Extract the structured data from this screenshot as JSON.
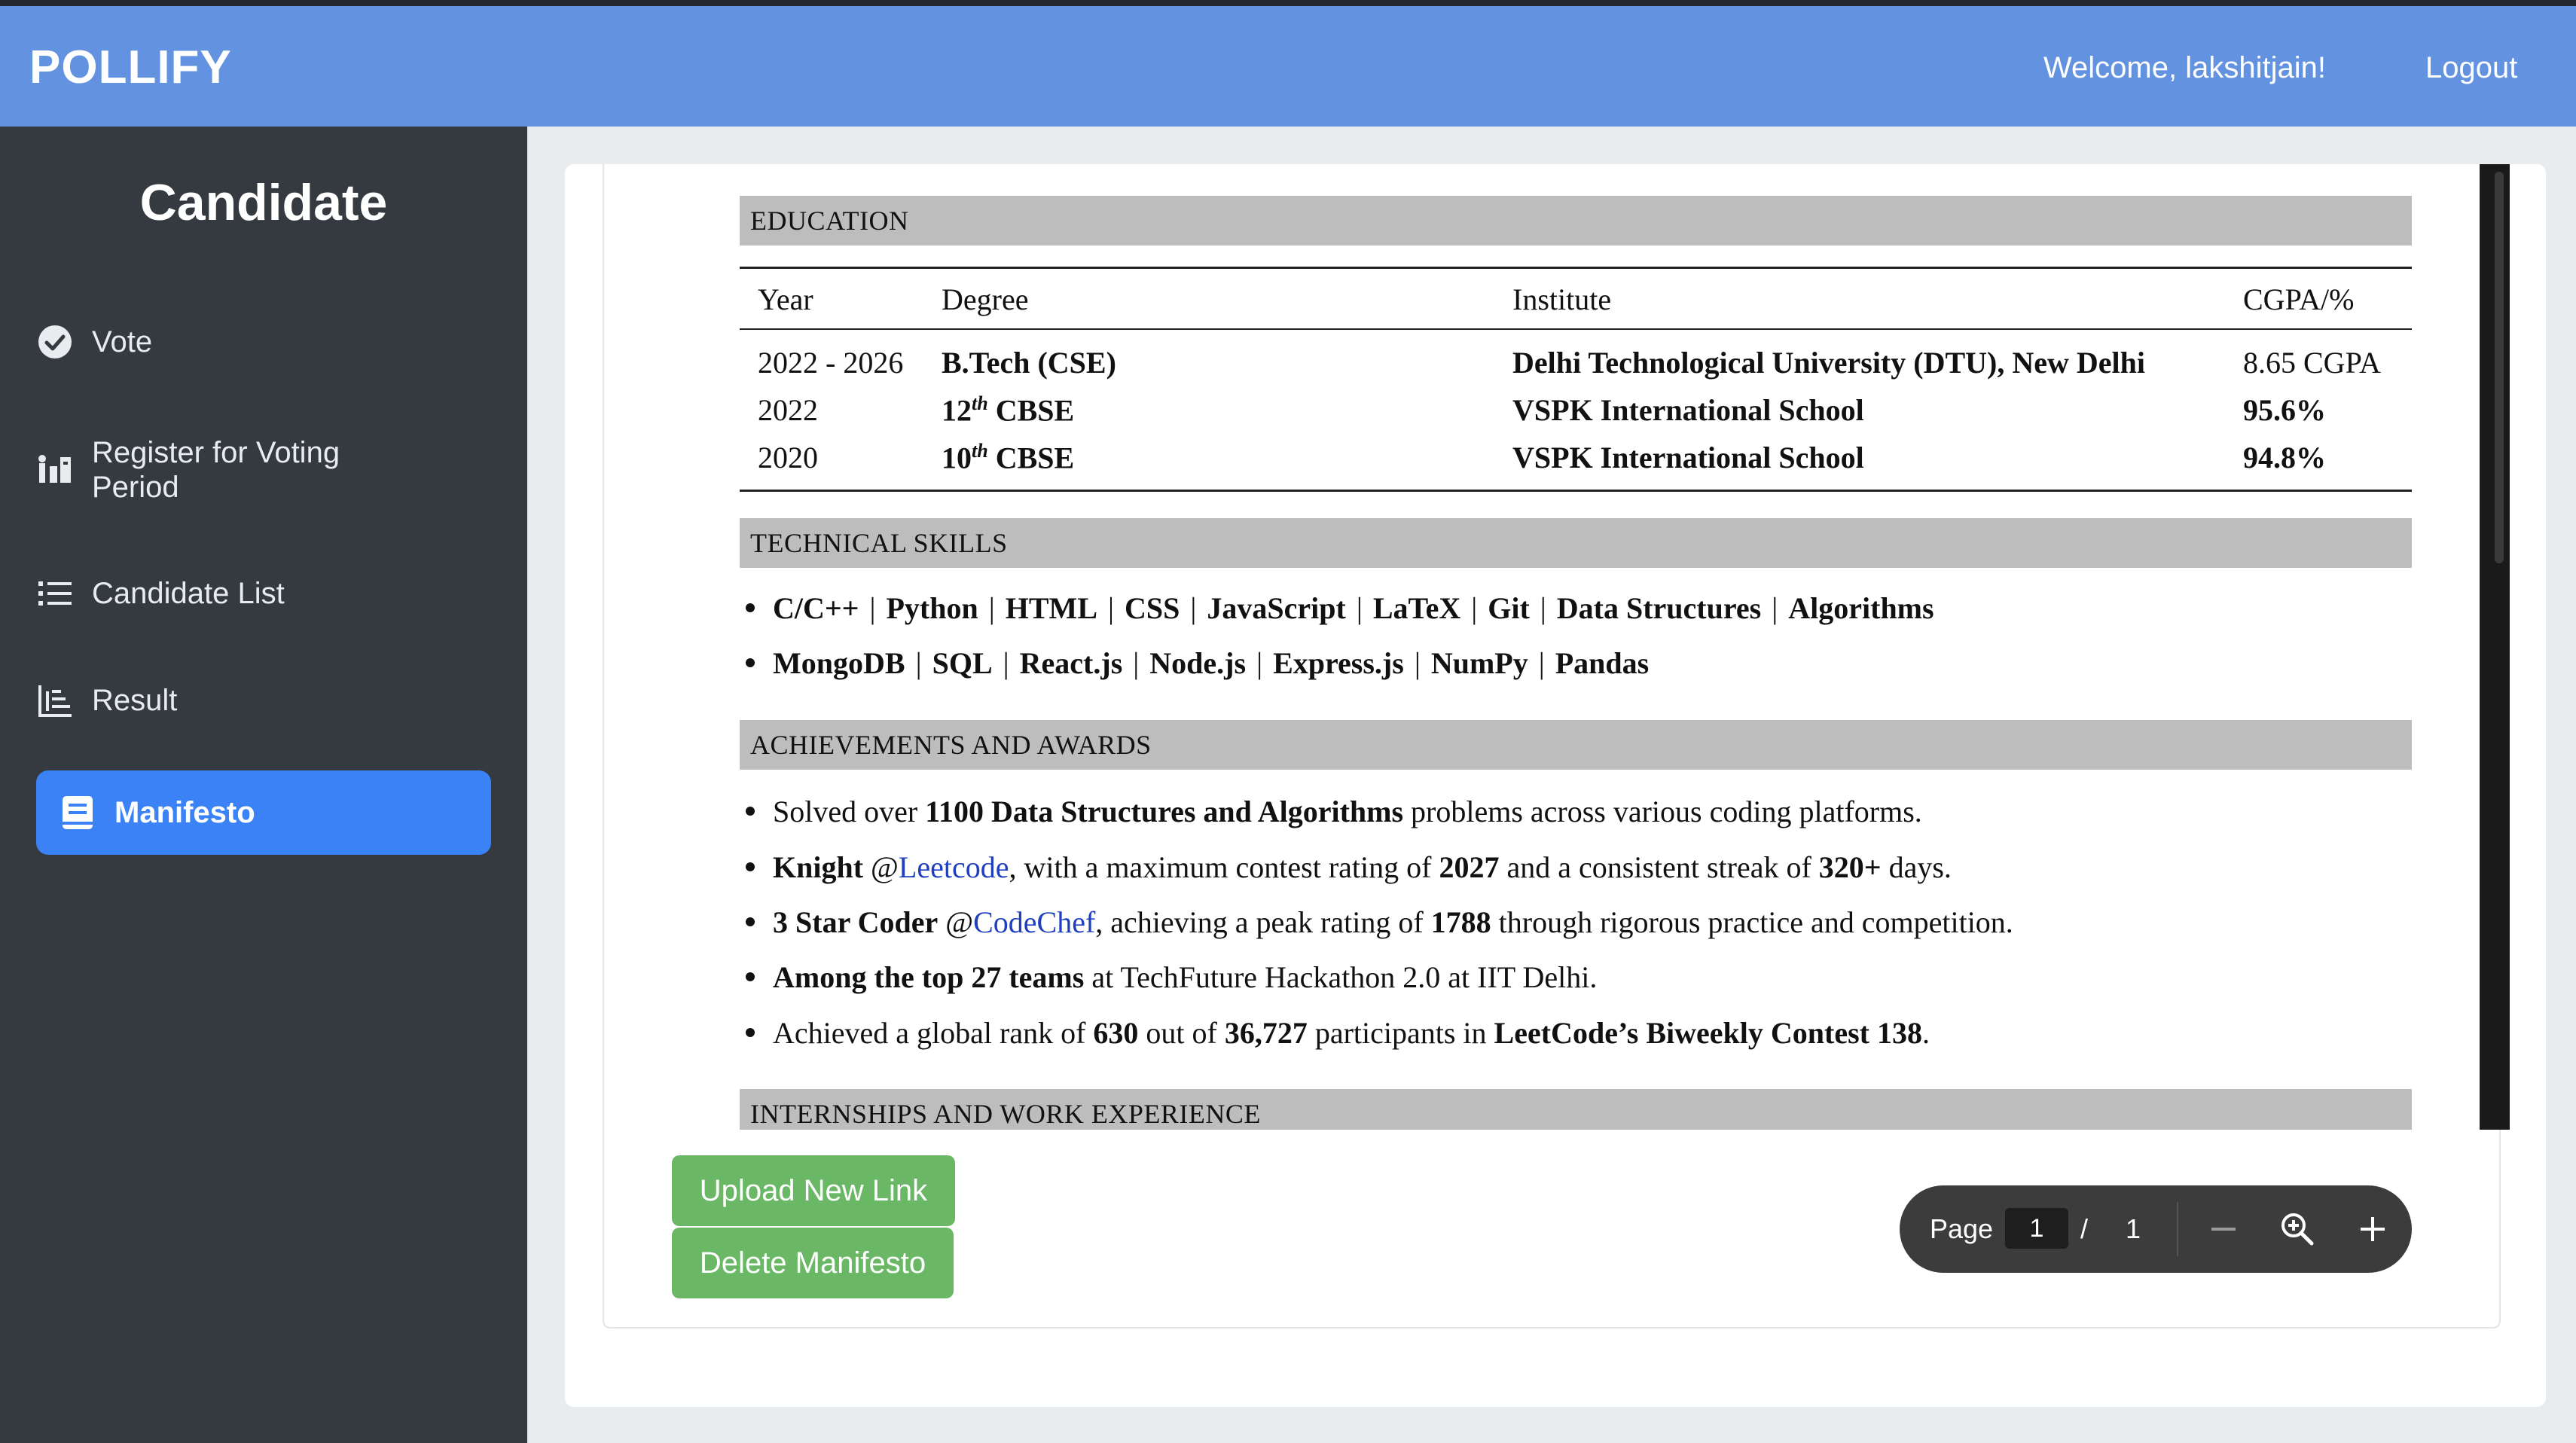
{
  "header": {
    "brand": "POLLIFY",
    "welcome": "Welcome, lakshitjain!",
    "logout": "Logout",
    "color": "#6292e0"
  },
  "sidebar": {
    "title": "Candidate",
    "items": [
      {
        "label": "Vote",
        "icon": "check-circle-icon"
      },
      {
        "label": "Register for Voting Period",
        "icon": "register-icon"
      },
      {
        "label": "Candidate List",
        "icon": "list-icon"
      },
      {
        "label": "Result",
        "icon": "bar-chart-icon"
      },
      {
        "label": "Manifesto",
        "icon": "book-icon",
        "active": true
      }
    ],
    "active_color": "#3b82f6"
  },
  "document": {
    "education": {
      "heading": "EDUCATION",
      "columns": [
        "Year",
        "Degree",
        "Institute",
        "CGPA/%"
      ],
      "rows": [
        {
          "year": "2022 - 2026",
          "degree": "B.Tech (CSE)",
          "degree_sup": "",
          "degree_suffix": "",
          "institute": "Delhi Technological University (DTU), New Delhi",
          "score": "8.65 CGPA"
        },
        {
          "year": "2022",
          "degree": "12",
          "degree_sup": "th",
          "degree_suffix": "CBSE",
          "institute": "VSPK International School",
          "score": "95.6%"
        },
        {
          "year": "2020",
          "degree": "10",
          "degree_sup": "th",
          "degree_suffix": "CBSE",
          "institute": "VSPK International School",
          "score": "94.8%"
        }
      ]
    },
    "skills": {
      "heading": "TECHNICAL SKILLS",
      "line1": [
        "C/C++",
        "Python",
        "HTML",
        "CSS",
        "JavaScript",
        "LaTeX",
        "Git",
        "Data Structures",
        "Algorithms"
      ],
      "line2": [
        "MongoDB",
        "SQL",
        "React.js",
        "Node.js",
        "Express.js",
        "NumPy",
        "Pandas"
      ]
    },
    "achievements": {
      "heading": "ACHIEVEMENTS AND AWARDS",
      "a1": {
        "pre": "Solved over ",
        "bold": "1100 Data Structures and Algorithms",
        "post": " problems across various coding platforms."
      },
      "a2": {
        "bold1": "Knight",
        "at": " @",
        "link": "Leetcode",
        "mid": ", with a maximum contest rating of ",
        "bold2": "2027",
        "mid2": " and a consistent streak of ",
        "bold3": "320+",
        "post": " days."
      },
      "a3": {
        "bold1": "3 Star Coder",
        "at": " @",
        "link": "CodeChef",
        "mid": ", achieving a peak rating of ",
        "bold2": "1788",
        "post": " through rigorous practice and competition."
      },
      "a4": {
        "bold": "Among the top 27 teams",
        "post": " at TechFuture Hackathon 2.0 at IIT Delhi."
      },
      "a5": {
        "pre": "Achieved a global rank of ",
        "bold1": "630",
        "mid": " out of ",
        "bold2": "36,727",
        "mid2": " participants in ",
        "bold3": "LeetCode’s Biweekly Contest 138",
        "post": "."
      }
    },
    "internships": {
      "heading": "INTERNSHIPS AND WORK EXPERIENCE"
    }
  },
  "pdf_toolbar": {
    "page_label": "Page",
    "current_page": "1",
    "slash": "/",
    "total_pages": "1"
  },
  "actions": {
    "upload": "Upload New Link",
    "delete": "Delete Manifesto",
    "color": "#6ab866"
  }
}
